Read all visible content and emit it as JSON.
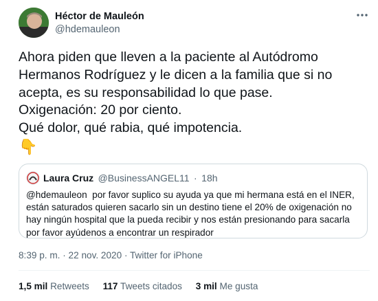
{
  "author": {
    "name": "Héctor de Mauleón",
    "handle": "@hdemauleon"
  },
  "tweet": {
    "text": "Ahora piden que lleven a la paciente al Autódromo Hermanos Rodríguez y le dicen a la familia que si no acepta, es su responsabilidad lo que pase.\nOxigenación: 20 por ciento.\nQué dolor, qué rabia, qué impotencia.",
    "emoji": "👇"
  },
  "quote": {
    "name": "Laura Cruz",
    "handle": "@BusinessANGEL11",
    "separator": "·",
    "time": "18h",
    "text": "@hdemauleon  por favor suplico su ayuda ya que mi hermana está en el INER, están saturados quieren sacarlo sin un destino tiene el 20% de oxigenación no hay ningún hospital que la pueda recibir y nos están presionando para sacarla por favor ayúdenos a encontrar un respirador"
  },
  "meta": {
    "time": "8:39 p. m.",
    "sep1": "·",
    "date": "22 nov. 2020",
    "sep2": "·",
    "source": "Twitter for iPhone"
  },
  "stats": [
    {
      "count": "1,5 mil",
      "label": "Retweets"
    },
    {
      "count": "117",
      "label": "Tweets citados"
    },
    {
      "count": "3 mil",
      "label": "Me gusta"
    }
  ],
  "colors": {
    "text": "#0f1419",
    "secondary": "#536471",
    "border": "#cfd9de"
  },
  "icons": {
    "more": "more-icon"
  }
}
